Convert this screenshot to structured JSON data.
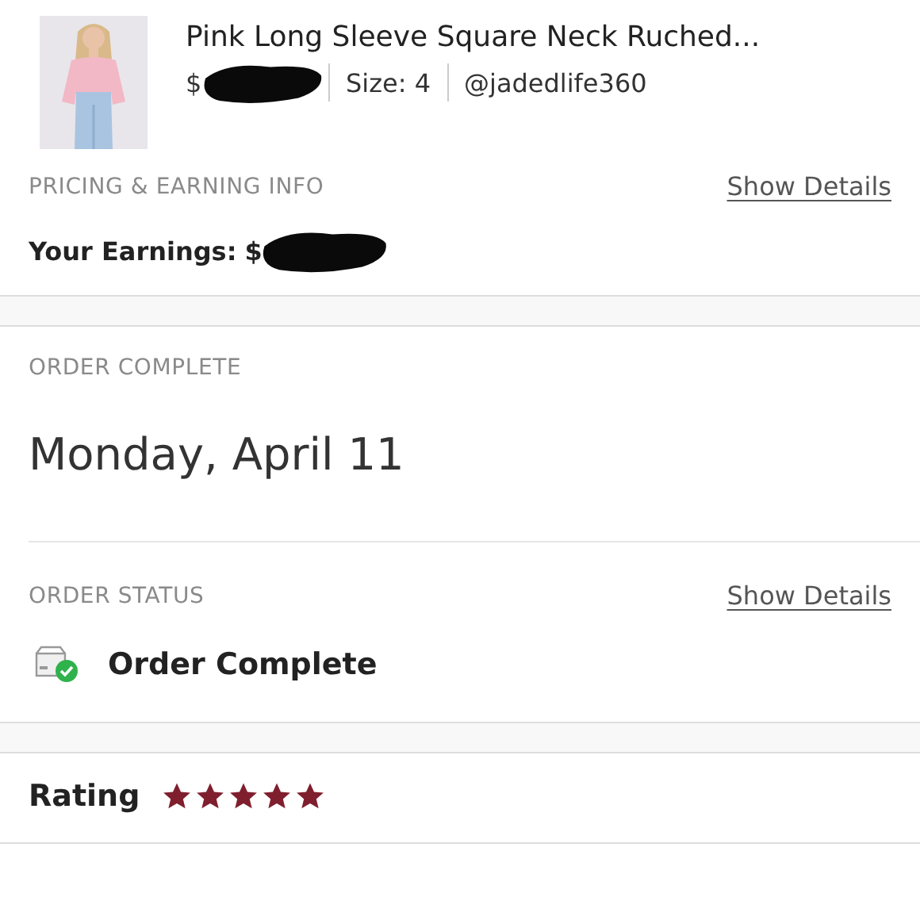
{
  "product": {
    "kind": "picture",
    "title": "Pink Long Sleeve Square Neck Ruched...",
    "price": "$",
    "size": "Size: 4",
    "seller": "@jadedlife360"
  },
  "pricing": {
    "heading": "PRICING & EARNING INFO",
    "link": "Show Details",
    "earnings_label": "Your Earnings:",
    "earnings_value": "$"
  },
  "order_complete": {
    "heading": "ORDER COMPLETE",
    "date": "Monday, April 11"
  },
  "order_status": {
    "heading": "ORDER STATUS",
    "link": "Show Details",
    "status": "Order Complete"
  },
  "rating": {
    "label": "Rating",
    "stars": 5
  }
}
